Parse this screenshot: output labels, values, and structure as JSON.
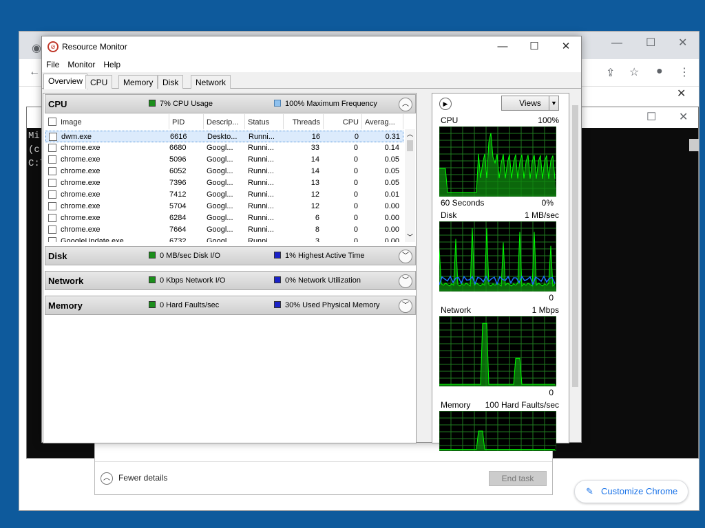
{
  "window": {
    "title": "Resource Monitor",
    "minimize": "—",
    "maximize": "☐",
    "close": "✕"
  },
  "menu": [
    "File",
    "Monitor",
    "Help"
  ],
  "tabs": [
    "Overview",
    "CPU",
    "Memory",
    "Disk",
    "Network"
  ],
  "cpu_section": {
    "name": "CPU",
    "metric1": "7% CPU Usage",
    "metric2": "100% Maximum Frequency",
    "columns": [
      "Image",
      "PID",
      "Descrip...",
      "Status",
      "Threads",
      "CPU",
      "Averag..."
    ],
    "rows": [
      {
        "image": "dwm.exe",
        "pid": "6616",
        "desc": "Deskto...",
        "status": "Runni...",
        "threads": "16",
        "cpu": "0",
        "avg": "0.31"
      },
      {
        "image": "chrome.exe",
        "pid": "6680",
        "desc": "Googl...",
        "status": "Runni...",
        "threads": "33",
        "cpu": "0",
        "avg": "0.14"
      },
      {
        "image": "chrome.exe",
        "pid": "5096",
        "desc": "Googl...",
        "status": "Runni...",
        "threads": "14",
        "cpu": "0",
        "avg": "0.05"
      },
      {
        "image": "chrome.exe",
        "pid": "6052",
        "desc": "Googl...",
        "status": "Runni...",
        "threads": "14",
        "cpu": "0",
        "avg": "0.05"
      },
      {
        "image": "chrome.exe",
        "pid": "7396",
        "desc": "Googl...",
        "status": "Runni...",
        "threads": "13",
        "cpu": "0",
        "avg": "0.05"
      },
      {
        "image": "chrome.exe",
        "pid": "7412",
        "desc": "Googl...",
        "status": "Runni...",
        "threads": "12",
        "cpu": "0",
        "avg": "0.01"
      },
      {
        "image": "chrome.exe",
        "pid": "5704",
        "desc": "Googl...",
        "status": "Runni...",
        "threads": "12",
        "cpu": "0",
        "avg": "0.00"
      },
      {
        "image": "chrome.exe",
        "pid": "6284",
        "desc": "Googl...",
        "status": "Runni...",
        "threads": "6",
        "cpu": "0",
        "avg": "0.00"
      },
      {
        "image": "chrome.exe",
        "pid": "7664",
        "desc": "Googl...",
        "status": "Runni...",
        "threads": "8",
        "cpu": "0",
        "avg": "0.00"
      },
      {
        "image": "GoogleUpdate.exe",
        "pid": "6732",
        "desc": "Googl...",
        "status": "Runni...",
        "threads": "3",
        "cpu": "0",
        "avg": "0.00"
      }
    ]
  },
  "disk_section": {
    "name": "Disk",
    "metric1": "0 MB/sec Disk I/O",
    "metric2": "1% Highest Active Time"
  },
  "network_section": {
    "name": "Network",
    "metric1": "0 Kbps Network I/O",
    "metric2": "0% Network Utilization"
  },
  "memory_section": {
    "name": "Memory",
    "metric1": "0 Hard Faults/sec",
    "metric2": "30% Used Physical Memory"
  },
  "right_pane": {
    "views_label": "Views",
    "graphs": [
      {
        "name": "CPU",
        "max": "100%",
        "foot_left": "60 Seconds",
        "foot_right": "0%"
      },
      {
        "name": "Disk",
        "max": "1 MB/sec",
        "foot_left": "",
        "foot_right": "0"
      },
      {
        "name": "Network",
        "max": "1 Mbps",
        "foot_left": "",
        "foot_right": "0"
      },
      {
        "name": "Memory",
        "max": "100 Hard Faults/sec",
        "foot_left": "",
        "foot_right": ""
      }
    ]
  },
  "background": {
    "console_lines": [
      "Mi",
      "(c",
      "",
      "C:\\"
    ],
    "task_manager": {
      "fewer_details": "Fewer details",
      "end_task": "End task"
    },
    "chrome": {
      "customize": "Customize Chrome"
    }
  },
  "colors": {
    "graph_bg": "#000000",
    "grid": "#1f7a1f",
    "cpu_line": "#00ff00",
    "disk_line2": "#1e6fff"
  }
}
